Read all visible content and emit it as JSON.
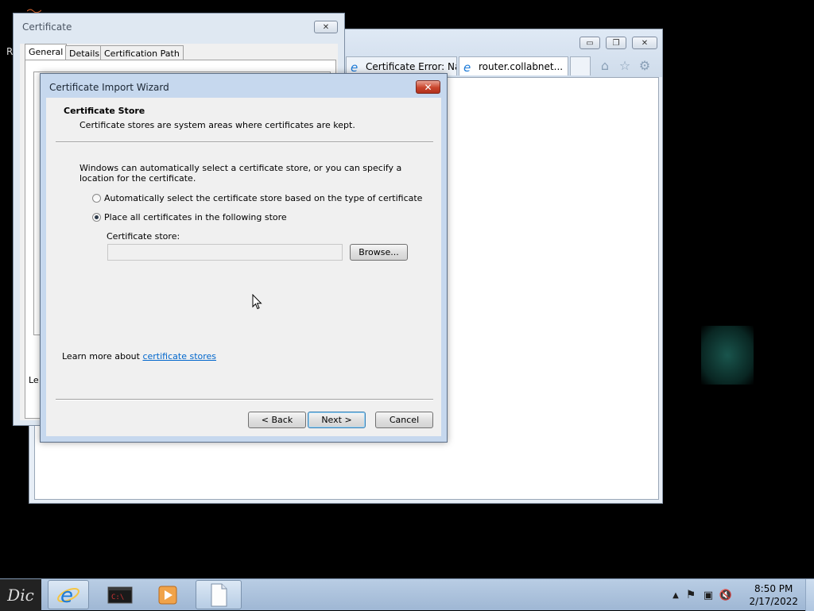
{
  "browser": {
    "tabs": [
      {
        "label": "Certificate Error: Na...",
        "active": false
      },
      {
        "label": "router.collabnet...",
        "active": true
      }
    ],
    "buttons": {
      "minimize": "▭",
      "restore": "❐",
      "close": "✕"
    },
    "icons": [
      "home-icon",
      "favorites-star-icon",
      "tools-gear-icon"
    ]
  },
  "certificate_dialog": {
    "title": "Certificate",
    "tabs": [
      "General",
      "Details",
      "Certification Path"
    ],
    "partial_text_left": "R",
    "partial_text_bottom": "Le"
  },
  "wizard": {
    "title": "Certificate Import Wizard",
    "header_title": "Certificate Store",
    "header_subtitle": "Certificate stores are system areas where certificates are kept.",
    "description": "Windows can automatically select a certificate store, or you can specify a location for the certificate.",
    "options": [
      {
        "label": "Automatically select the certificate store based on the type of certificate",
        "checked": false
      },
      {
        "label": "Place all certificates in the following store",
        "checked": true
      }
    ],
    "store_label": "Certificate store:",
    "store_value": "",
    "browse_label": "Browse...",
    "learn_prefix": "Learn more about ",
    "learn_link": "certificate stores",
    "back_label": "< Back",
    "next_label": "Next >",
    "cancel_label": "Cancel"
  },
  "taskbar": {
    "start_label": "Dic",
    "pinned": [
      "internet-explorer",
      "command-prompt",
      "media-player",
      "blank-document"
    ],
    "clock_time": "8:50 PM",
    "clock_date": "2/17/2022"
  },
  "colors": {
    "wizard_frame": "#c6d8ee",
    "close_red": "#c9452d",
    "link": "#0066cc",
    "taskbar": "#b9cde4"
  }
}
